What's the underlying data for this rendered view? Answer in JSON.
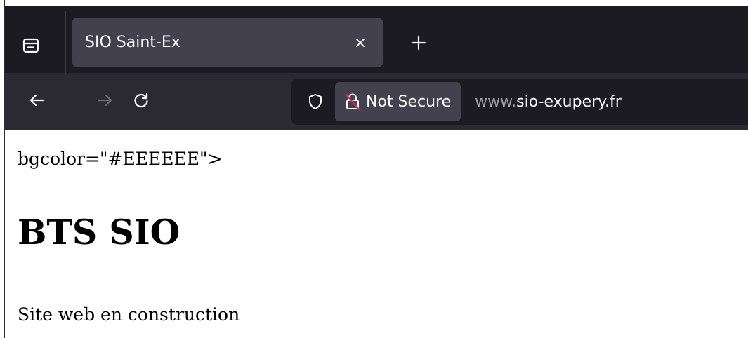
{
  "browser": {
    "tab": {
      "title": "SIO Saint-Ex",
      "close_icon": "close-icon"
    },
    "new_tab_icon": "plus-icon",
    "list_tabs_icon": "tab-list-icon",
    "nav": {
      "back_icon": "arrow-left-icon",
      "forward_icon": "arrow-right-icon",
      "reload_icon": "reload-icon"
    },
    "urlbar": {
      "shield_icon": "shield-icon",
      "lock_icon": "insecure-lock-icon",
      "security_label": "Not Secure",
      "url_prefix": "www.",
      "url_domain": "sio-exupery.fr"
    },
    "colors": {
      "tabstrip": "#1c1b22",
      "toolbar": "#2b2a33",
      "selected_tab": "#42414d",
      "insecure_slash": "#e22850"
    }
  },
  "page": {
    "stray_text": "bgcolor=\"#EEEEEE\">",
    "heading": "BTS SIO",
    "paragraph": "Site web en construction"
  }
}
